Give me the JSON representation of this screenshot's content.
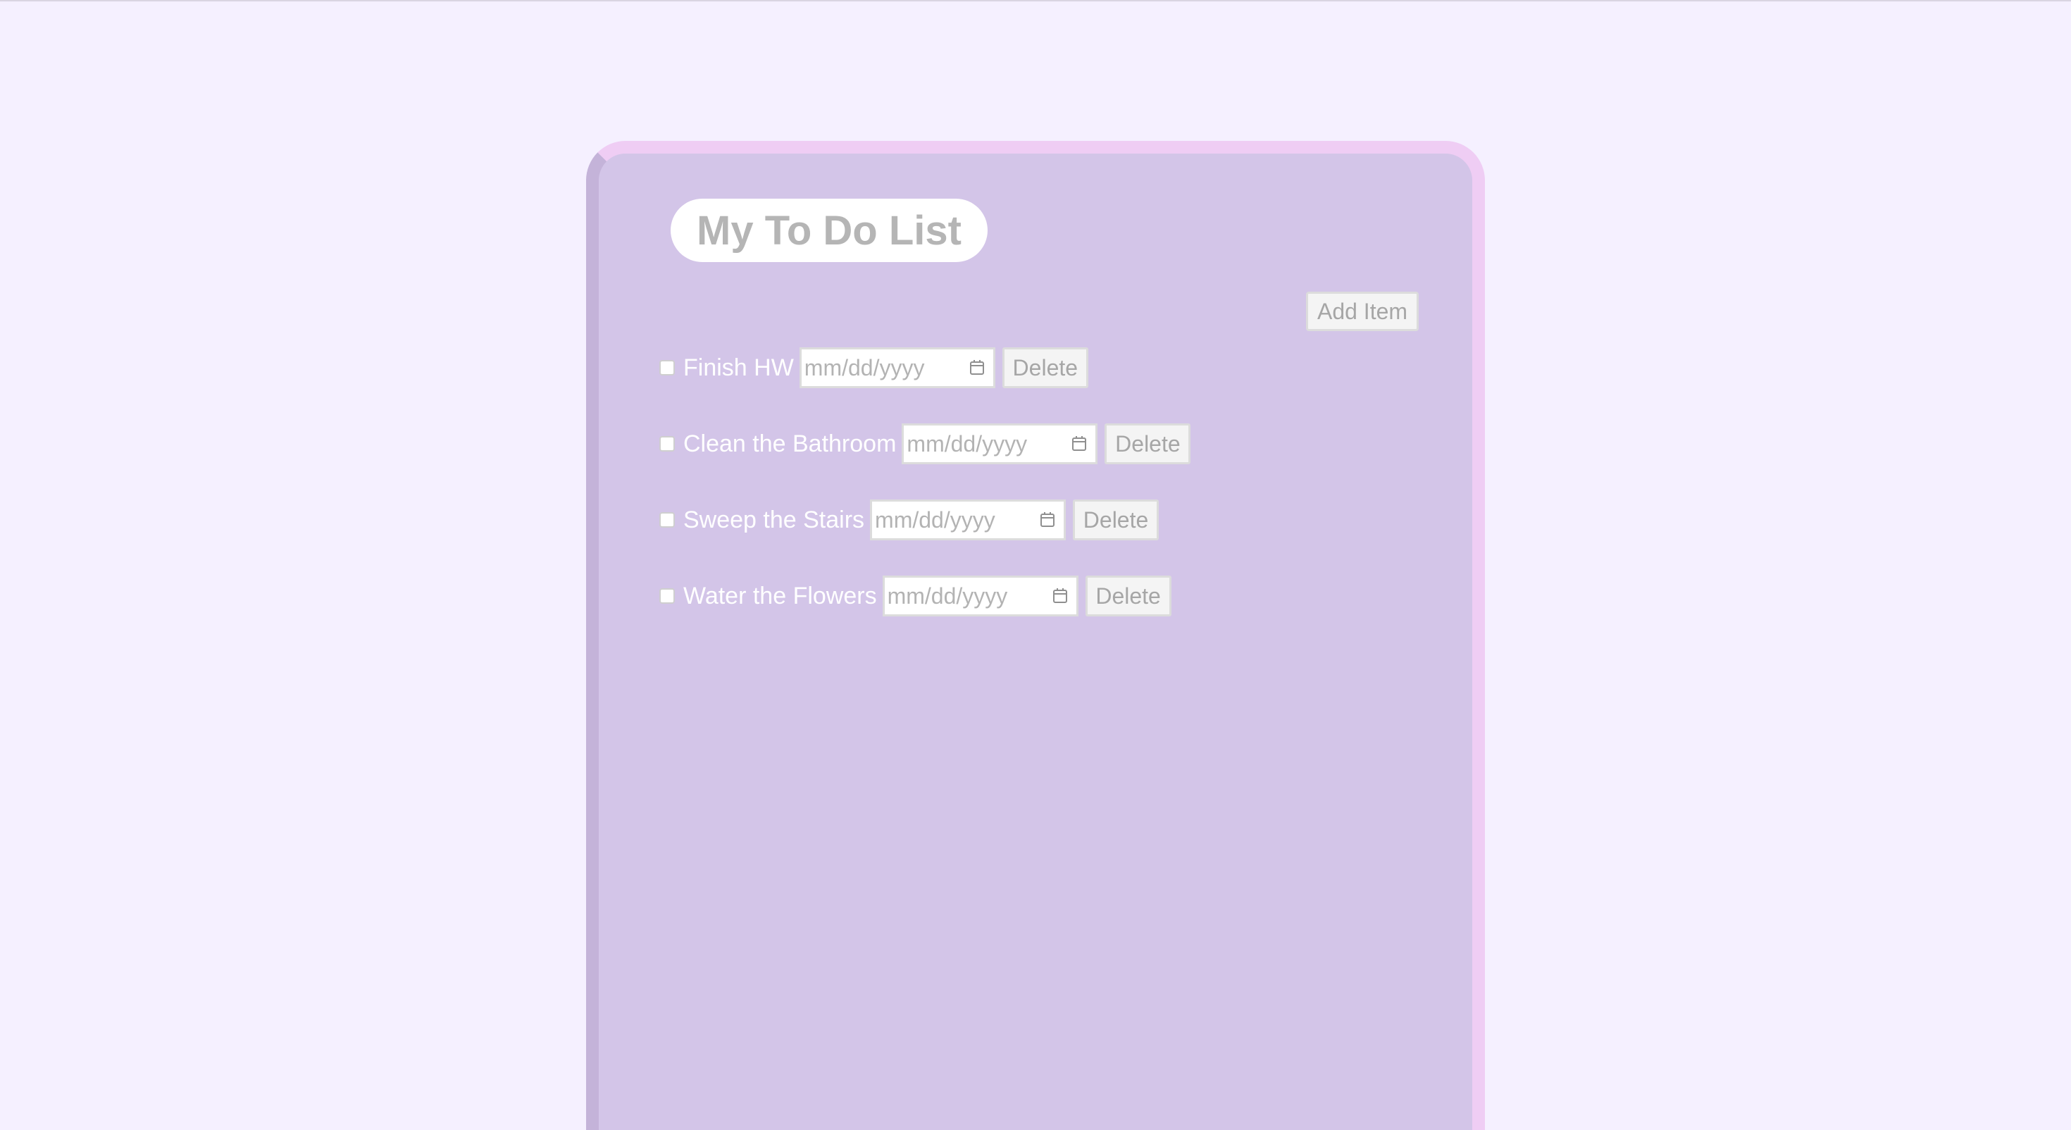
{
  "app": {
    "title": "My To Do List"
  },
  "toolbar": {
    "add_label": "Add Item"
  },
  "todos": [
    {
      "label": "Finish HW",
      "date_placeholder": "mm/dd/yyyy",
      "delete_label": "Delete",
      "checked": false
    },
    {
      "label": "Clean the Bathroom",
      "date_placeholder": "mm/dd/yyyy",
      "delete_label": "Delete",
      "checked": false
    },
    {
      "label": "Sweep the Stairs",
      "date_placeholder": "mm/dd/yyyy",
      "delete_label": "Delete",
      "checked": false
    },
    {
      "label": "Water the Flowers",
      "date_placeholder": "mm/dd/yyyy",
      "delete_label": "Delete",
      "checked": false
    }
  ],
  "icons": {
    "date": "calendar-icon"
  },
  "colors": {
    "page_background": "#f5f0ff",
    "card_background": "#d3c5e8",
    "card_border_light": "#efcdf4",
    "card_border_dark": "#c4b3d9",
    "title_text": "#b5b5b5"
  }
}
